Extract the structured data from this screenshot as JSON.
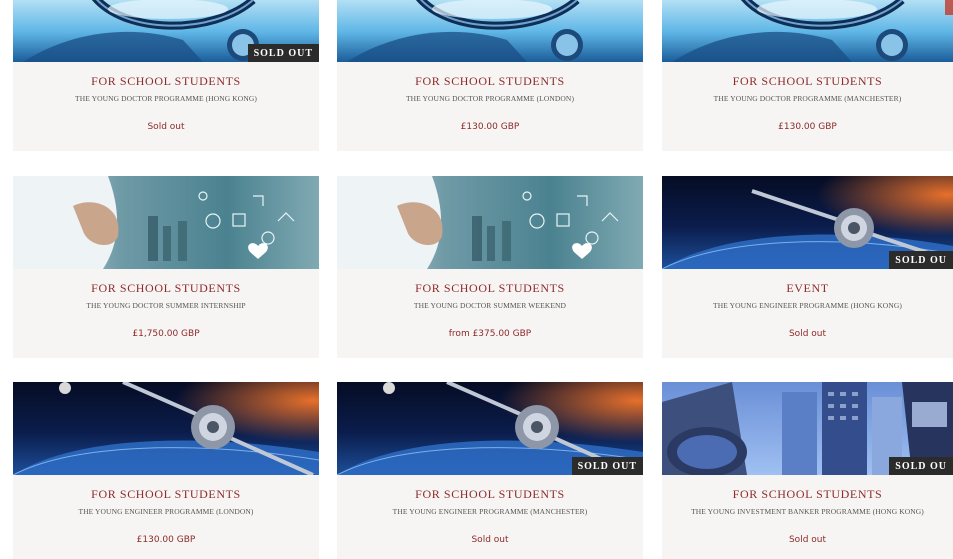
{
  "products": [
    {
      "category": "FOR SCHOOL STUDENTS",
      "title": "THE YOUNG DOCTOR PROGRAMME (HONG KONG)",
      "price": "Sold out",
      "badge": "SOLD OUT",
      "image": "stethoscope-image"
    },
    {
      "category": "FOR SCHOOL STUDENTS",
      "title": "THE YOUNG DOCTOR PROGRAMME (LONDON)",
      "price": "£130.00 GBP",
      "badge": "",
      "image": "stethoscope-image"
    },
    {
      "category": "FOR SCHOOL STUDENTS",
      "title": "THE YOUNG DOCTOR PROGRAMME (MANCHESTER)",
      "price": "£130.00 GBP",
      "badge": "",
      "image": "stethoscope-image"
    },
    {
      "category": "FOR SCHOOL STUDENTS",
      "title": "THE YOUNG DOCTOR SUMMER INTERNSHIP",
      "price": "£1,750.00 GBP",
      "badge": "",
      "image": "medical-tech-image"
    },
    {
      "category": "FOR SCHOOL STUDENTS",
      "title": "THE YOUNG DOCTOR SUMMER WEEKEND",
      "price": "from £375.00 GBP",
      "badge": "",
      "image": "medical-tech-image"
    },
    {
      "category": "EVENT",
      "title": "THE YOUNG ENGINEER PROGRAMME (HONG KONG)",
      "price": "Sold out",
      "badge": "SOLD OU",
      "image": "satellite-image"
    },
    {
      "category": "FOR SCHOOL STUDENTS",
      "title": "THE YOUNG ENGINEER PROGRAMME (LONDON)",
      "price": "£130.00 GBP",
      "badge": "",
      "image": "satellite-image"
    },
    {
      "category": "FOR SCHOOL STUDENTS",
      "title": "THE YOUNG ENGINEER PROGRAMME (MANCHESTER)",
      "price": "Sold out",
      "badge": "SOLD OUT",
      "image": "satellite-image"
    },
    {
      "category": "FOR SCHOOL STUDENTS",
      "title": "THE YOUNG INVESTMENT BANKER PROGRAMME (HONG KONG)",
      "price": "Sold out",
      "badge": "SOLD OU",
      "image": "city-image"
    }
  ]
}
